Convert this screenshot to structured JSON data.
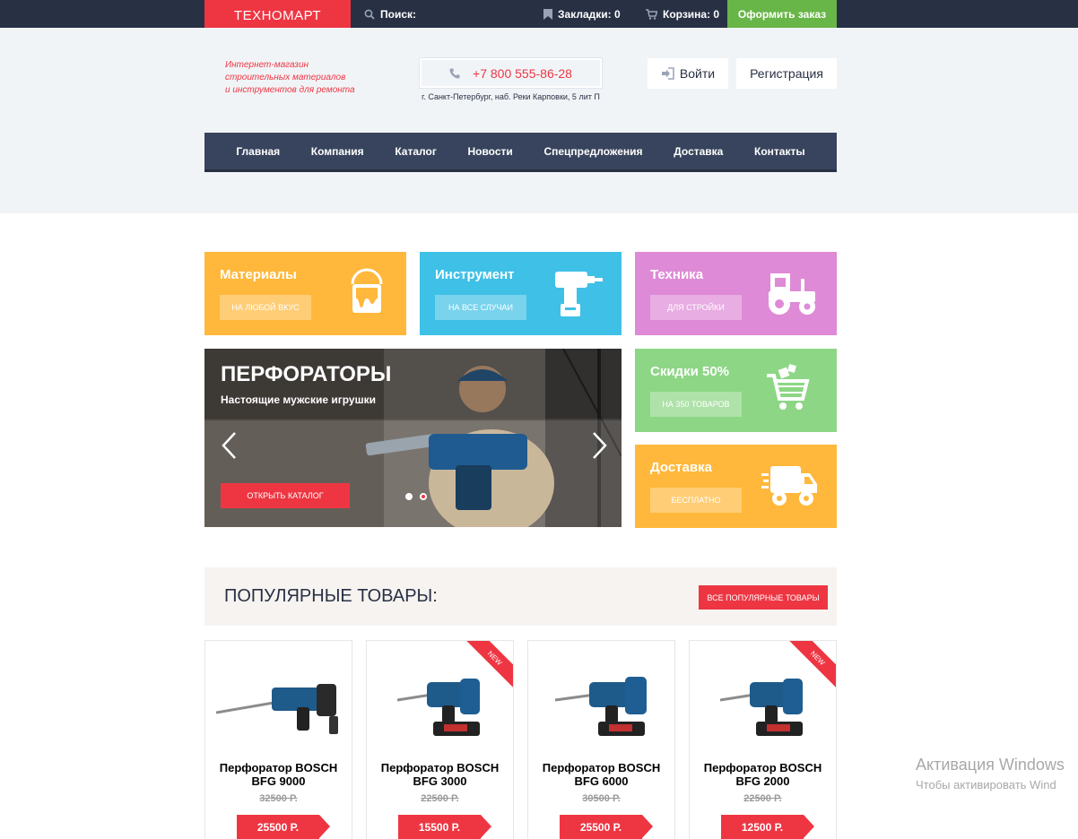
{
  "topbar": {
    "logo": "ТЕХНОМАРТ",
    "search": "Поиск:",
    "bookmarks": "Закладки: 0",
    "cart": "Корзина: 0",
    "order": "Оформить заказ"
  },
  "header": {
    "tagline": [
      "Интернет-магазин",
      "строительных материалов",
      "и инструментов для ремонта"
    ],
    "phone": "+7 800 555-86-28",
    "address": "г. Санкт-Петербург, наб. Реки Карповки, 5 лит П",
    "login": "Войти",
    "register": "Регистрация"
  },
  "nav": [
    "Главная",
    "Компания",
    "Каталог",
    "Новости",
    "Спецпредложения",
    "Доставка",
    "Контакты"
  ],
  "tiles": [
    {
      "title": "Материалы",
      "button": "НА ЛЮБОЙ ВКУС",
      "color": "#ffb83b",
      "icon": "paint-bucket-icon"
    },
    {
      "title": "Инструмент",
      "button": "НА ВСЕ СЛУЧАИ",
      "color": "#3fc0e6",
      "icon": "drill-icon"
    },
    {
      "title": "Техника",
      "button": "ДЛЯ СТРОЙКИ",
      "color": "#df8ad6",
      "icon": "tractor-icon"
    },
    {
      "title": "Скидки 50%",
      "button": "НА 350 ТОВАРОВ",
      "color": "#8dd685",
      "icon": "shopping-cart-icon"
    },
    {
      "title": "Доставка",
      "button": "БЕСПЛАТНО",
      "color": "#ffb83b",
      "icon": "delivery-truck-icon"
    }
  ],
  "slider": {
    "title": "ПЕРФОРАТОРЫ",
    "subtitle": "Настоящие мужские игрушки",
    "button": "ОТКРЫТЬ КАТАЛОГ"
  },
  "popular": {
    "title": "ПОПУЛЯРНЫЕ ТОВАРЫ:",
    "button": "ВСЕ ПОПУЛЯРНЫЕ ТОВАРЫ"
  },
  "products": [
    {
      "name1": "Перфоратор BOSCH",
      "name2": "BFG 9000",
      "old": "32500 Р.",
      "price": "25500 Р.",
      "is_new": false
    },
    {
      "name1": "Перфоратор BOSCH",
      "name2": "BFG 3000",
      "old": "22500 Р.",
      "price": "15500 Р.",
      "is_new": true,
      "badge": "NEW"
    },
    {
      "name1": "Перфоратор BOSCH",
      "name2": "BFG 6000",
      "old": "30500 Р.",
      "price": "25500 Р.",
      "is_new": false
    },
    {
      "name1": "Перфоратор BOSCH",
      "name2": "BFG 2000",
      "old": "22500 Р.",
      "price": "12500 Р.",
      "is_new": true,
      "badge": "NEW"
    }
  ],
  "watermark": {
    "line1": "Активация Windows",
    "line2": "Чтобы активировать Wind"
  },
  "colors": {
    "accent": "#ee3643",
    "dark": "#283044",
    "nav": "#38445d",
    "green": "#68b548"
  }
}
